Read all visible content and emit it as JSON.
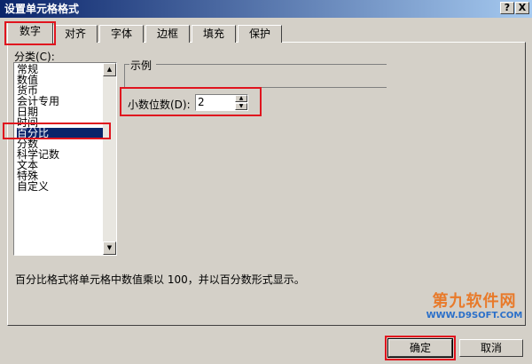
{
  "window": {
    "title": "设置单元格格式",
    "help_label": "?",
    "close_label": "X"
  },
  "tabs": [
    {
      "label": "数字"
    },
    {
      "label": "对齐"
    },
    {
      "label": "字体"
    },
    {
      "label": "边框"
    },
    {
      "label": "填充"
    },
    {
      "label": "保护"
    }
  ],
  "category": {
    "label": "分类(C):",
    "items": [
      "常规",
      "数值",
      "货币",
      "会计专用",
      "日期",
      "时间",
      "百分比",
      "分数",
      "科学记数",
      "文本",
      "特殊",
      "自定义"
    ],
    "selected": "百分比"
  },
  "sample": {
    "label": "示例"
  },
  "decimal": {
    "label": "小数位数(D):",
    "value": "2"
  },
  "description": "百分比格式将单元格中数值乘以 100，并以百分数形式显示。",
  "watermark": {
    "main": "第九软件网",
    "sub": "WWW.D9SOFT.COM"
  },
  "buttons": {
    "ok": "确定",
    "cancel": "取消"
  },
  "colors": {
    "highlight": "#e0141e",
    "selection": "#0a246a",
    "dialog": "#d4d0c8"
  }
}
